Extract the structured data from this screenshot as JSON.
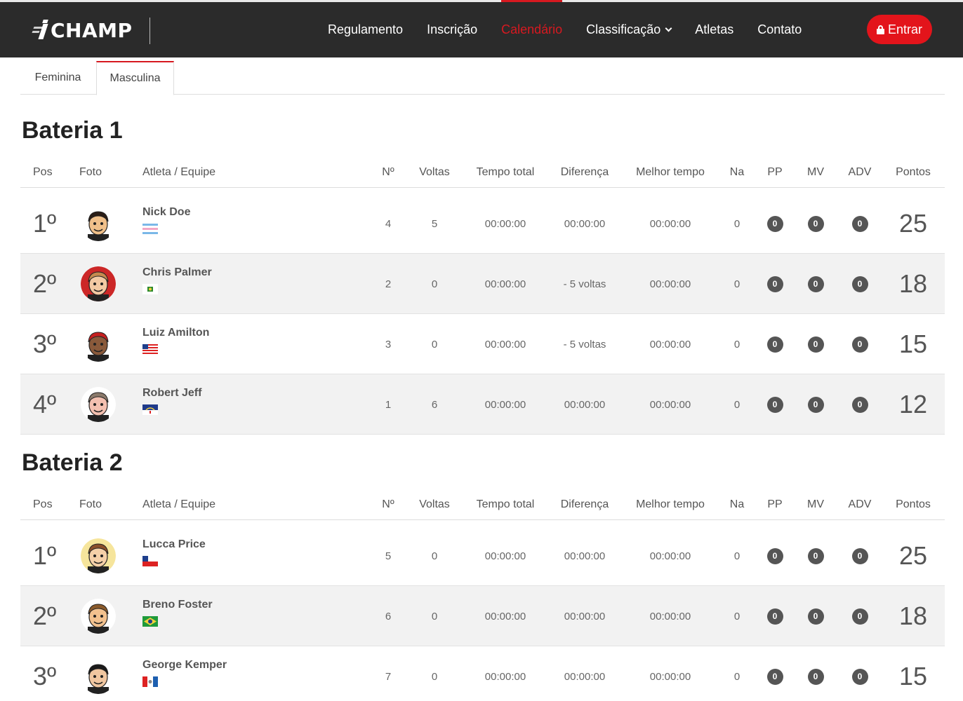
{
  "brand": {
    "name": "CHAMP"
  },
  "nav": {
    "items": [
      {
        "label": "Regulamento",
        "active": false
      },
      {
        "label": "Inscrição",
        "active": false
      },
      {
        "label": "Calendário",
        "active": true
      },
      {
        "label": "Classificação",
        "active": false,
        "dropdown": true
      },
      {
        "label": "Atletas",
        "active": false
      },
      {
        "label": "Contato",
        "active": false
      }
    ],
    "login_label": "Entrar",
    "login_icon": "lock-icon"
  },
  "tabs": [
    {
      "label": "Feminina",
      "active": false
    },
    {
      "label": "Masculina",
      "active": true
    }
  ],
  "columns": {
    "pos": "Pos",
    "foto": "Foto",
    "atleta": "Atleta / Equipe",
    "numero": "Nº",
    "voltas": "Voltas",
    "tempo_total": "Tempo total",
    "diferenca": "Diferença",
    "melhor_tempo": "Melhor tempo",
    "na": "Na",
    "pp": "PP",
    "mv": "MV",
    "adv": "ADV",
    "pontos": "Pontos"
  },
  "colors": {
    "accent": "#d71920",
    "navbar": "#2b2b2b",
    "badge": "#555555",
    "row_alt": "#f2f2f2"
  },
  "heats": [
    {
      "title": "Bateria 1",
      "rows": [
        {
          "pos": "1º",
          "name": "Nick Doe",
          "flag": "flag-stripes-blue-pink",
          "num": "4",
          "voltas": "5",
          "tempo_total": "00:00:00",
          "diferenca": "00:00:00",
          "melhor_tempo": "00:00:00",
          "na": "0",
          "pp": "0",
          "mv": "0",
          "adv": "0",
          "pontos": "25"
        },
        {
          "pos": "2º",
          "name": "Chris Palmer",
          "flag": "flag-green-square",
          "num": "2",
          "voltas": "0",
          "tempo_total": "00:00:00",
          "diferenca": "- 5 voltas",
          "melhor_tempo": "00:00:00",
          "na": "0",
          "pp": "0",
          "mv": "0",
          "adv": "0",
          "pontos": "18"
        },
        {
          "pos": "3º",
          "name": "Luiz Amilton",
          "flag": "flag-red-white-stripes",
          "num": "3",
          "voltas": "0",
          "tempo_total": "00:00:00",
          "diferenca": "- 5 voltas",
          "melhor_tempo": "00:00:00",
          "na": "0",
          "pp": "0",
          "mv": "0",
          "adv": "0",
          "pontos": "15"
        },
        {
          "pos": "4º",
          "name": "Robert Jeff",
          "flag": "flag-blue-arc",
          "num": "1",
          "voltas": "6",
          "tempo_total": "00:00:00",
          "diferenca": "00:00:00",
          "melhor_tempo": "00:00:00",
          "na": "0",
          "pp": "0",
          "mv": "0",
          "adv": "0",
          "pontos": "12"
        }
      ]
    },
    {
      "title": "Bateria 2",
      "rows": [
        {
          "pos": "1º",
          "name": "Lucca Price",
          "flag": "flag-white-red-blue",
          "num": "5",
          "voltas": "0",
          "tempo_total": "00:00:00",
          "diferenca": "00:00:00",
          "melhor_tempo": "00:00:00",
          "na": "0",
          "pp": "0",
          "mv": "0",
          "adv": "0",
          "pontos": "25"
        },
        {
          "pos": "2º",
          "name": "Breno Foster",
          "flag": "flag-green-yellow",
          "num": "6",
          "voltas": "0",
          "tempo_total": "00:00:00",
          "diferenca": "00:00:00",
          "melhor_tempo": "00:00:00",
          "na": "0",
          "pp": "0",
          "mv": "0",
          "adv": "0",
          "pontos": "18"
        },
        {
          "pos": "3º",
          "name": "George Kemper",
          "flag": "flag-red-blue-split",
          "num": "7",
          "voltas": "0",
          "tempo_total": "00:00:00",
          "diferenca": "00:00:00",
          "melhor_tempo": "00:00:00",
          "na": "0",
          "pp": "0",
          "mv": "0",
          "adv": "0",
          "pontos": "15"
        }
      ]
    }
  ]
}
